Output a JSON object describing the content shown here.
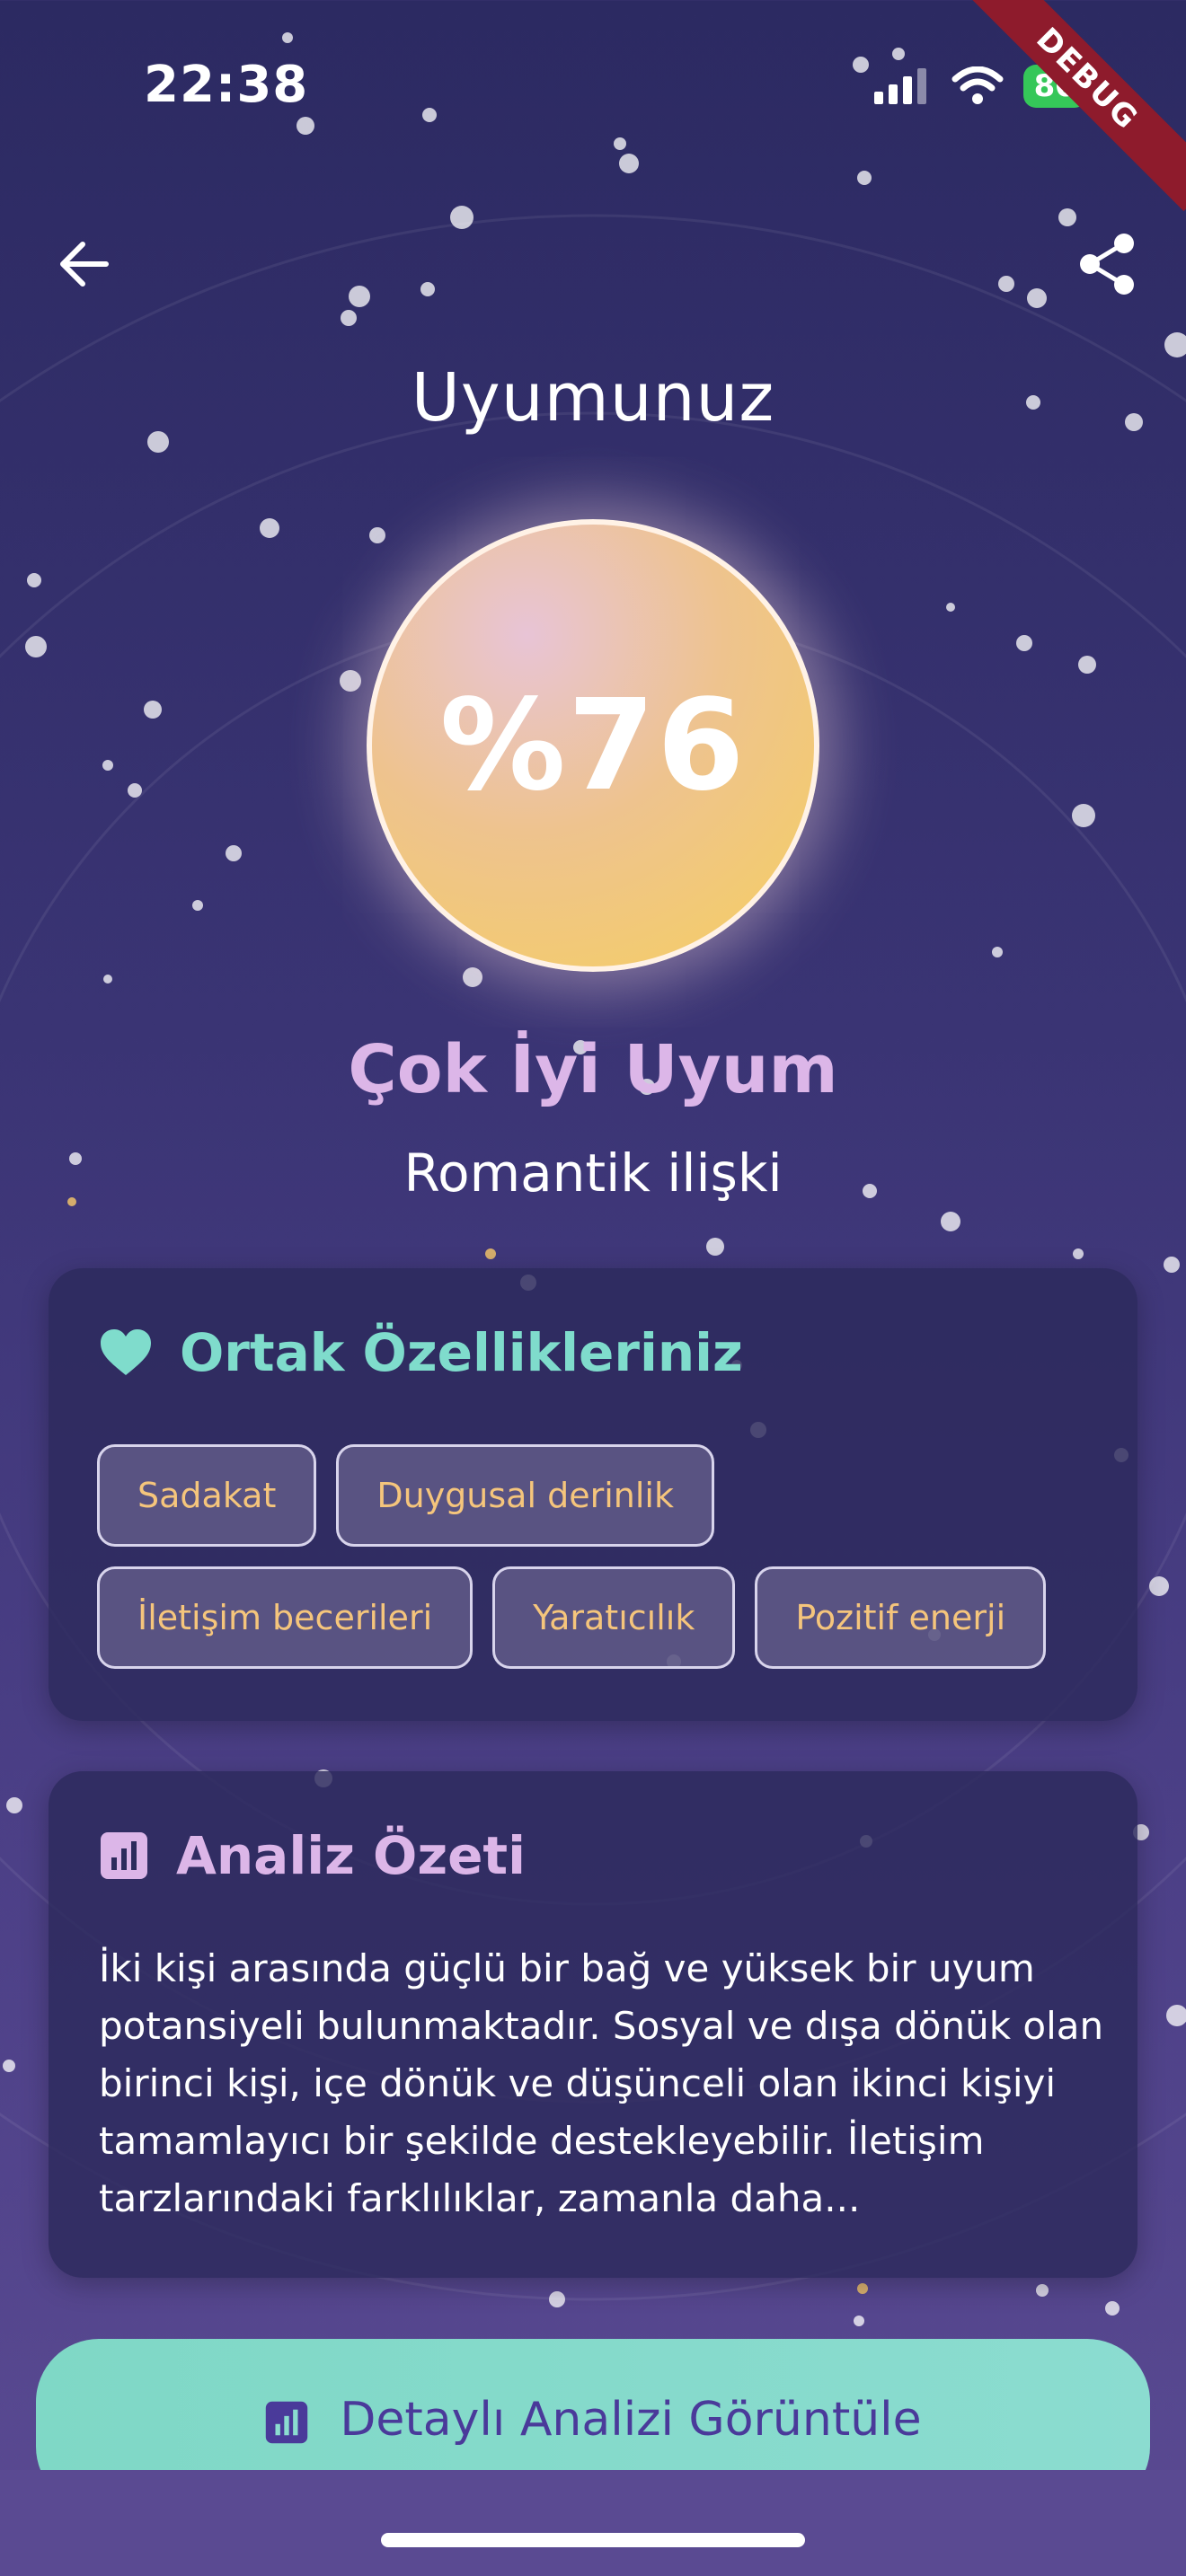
{
  "status_bar": {
    "time": "22:38",
    "battery": "80"
  },
  "debug_banner": "DEBUG",
  "header": {
    "title": "Uyumunuz"
  },
  "score": {
    "value": "%76",
    "percent": 76,
    "level": "Çok İyi Uyum",
    "relation": "Romantik ilişki"
  },
  "common_traits": {
    "title": "Ortak Özellikleriniz",
    "items": [
      "Sadakat",
      "Duygusal derinlik",
      "İletişim becerileri",
      "Yaratıcılık",
      "Pozitif enerji"
    ]
  },
  "analysis": {
    "title": "Analiz Özeti",
    "text": "İki kişi arasında güçlü bir bağ ve yüksek bir uyum potansiyeli bulunmaktadır. Sosyal ve dışa dönük olan birinci kişi, içe dönük ve düşünceli olan ikinci kişiyi tamamlayıcı bir şekilde destekleyebilir. İletişim tarzlarındaki farklılıklar, zamanla daha..."
  },
  "detail_button": {
    "label": "Detaylı Analizi Görüntüle"
  },
  "icons": {
    "back": "arrow-left-icon",
    "share": "share-icon",
    "heart": "heart-icon",
    "analytics": "bar-chart-icon",
    "signal": "signal-icon",
    "wifi": "wifi-icon"
  },
  "colors": {
    "background_top": "#2c2a62",
    "background_bottom": "#5a4a92",
    "accent_teal": "#7fdccc",
    "accent_pink": "#dcb6e8",
    "chip_text": "#f5c57c",
    "button": "#7fd8c6"
  }
}
